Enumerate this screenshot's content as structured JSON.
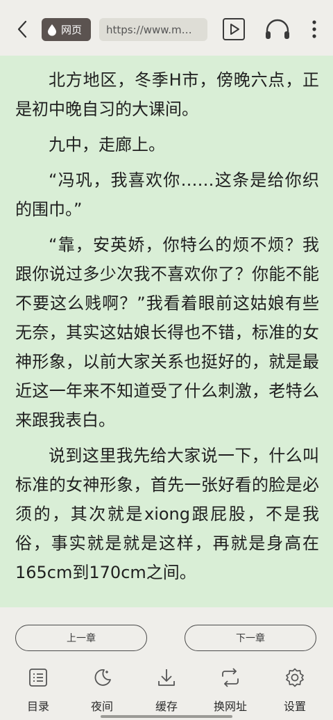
{
  "topbar": {
    "web_label": "网页",
    "url": "https://www.m…"
  },
  "reader": {
    "paragraphs": [
      "北方地区，冬季H市，傍晚六点，正是初中晚自习的大课间。",
      "九中，走廊上。",
      "“冯巩，我喜欢你……这条是给你织的围巾。”",
      "“靠，安英娇，你特么的烦不烦？我跟你说过多少次我不喜欢你了？你能不能不要这么贱啊？”我看着眼前这姑娘有些无奈，其实这姑娘长得也不错，标准的女神形象，以前大家关系也挺好的，就是最近这一年来不知道受了什么刺激，老特么来跟我表白。",
      "说到这里我先给大家说一下，什么叫标准的女神形象，首先一张好看的脸是必须的，其次就是xiong跟屁股，不是我俗，事实就是就是这样，再就是身高在165cm到170cm之间。"
    ]
  },
  "chapter_nav": {
    "prev_label": "上一章",
    "next_label": "下一章"
  },
  "toolbar": {
    "items": [
      {
        "label": "目录",
        "icon": "list-icon"
      },
      {
        "label": "夜间",
        "icon": "moon-icon"
      },
      {
        "label": "缓存",
        "icon": "download-icon"
      },
      {
        "label": "换网址",
        "icon": "swap-icon"
      },
      {
        "label": "设置",
        "icon": "gear-icon"
      }
    ]
  },
  "colors": {
    "reader_bg": "#d9eed6",
    "chrome_bg": "#efeeea",
    "badge_bg": "#5b5350"
  }
}
